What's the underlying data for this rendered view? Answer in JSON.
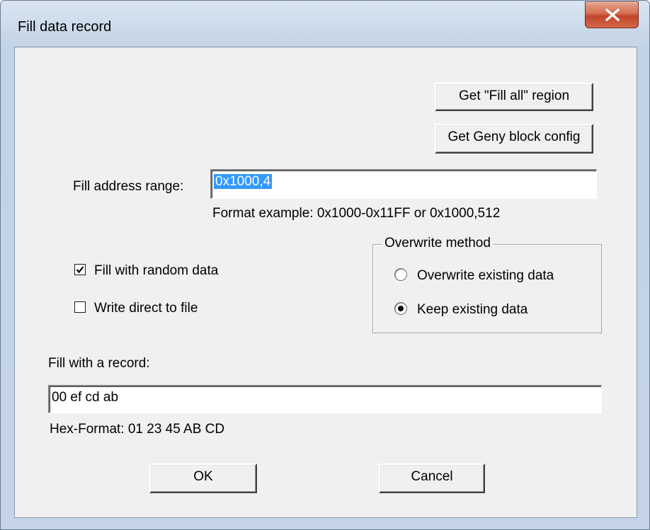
{
  "window": {
    "title": "Fill data record"
  },
  "buttons": {
    "fill_all_region": "Get \"Fill all\" region",
    "geny_block_config": "Get Geny block config",
    "ok": "OK",
    "cancel": "Cancel"
  },
  "address": {
    "label": "Fill address range:",
    "value": "0x1000,4",
    "hint": "Format example: 0x1000-0x11FF or 0x1000,512"
  },
  "options": {
    "random": {
      "label": "Fill with random data",
      "checked": true
    },
    "direct": {
      "label": "Write direct to file",
      "checked": false
    }
  },
  "overwrite": {
    "title": "Overwrite method",
    "options": [
      {
        "label": "Overwrite existing data",
        "selected": false
      },
      {
        "label": "Keep existing data",
        "selected": true
      }
    ]
  },
  "record": {
    "label": "Fill with a record:",
    "value": "00 ef cd ab",
    "hint": "Hex-Format:  01 23 45 AB CD"
  },
  "icons": {
    "close": "close-icon",
    "check": "checkmark-icon"
  }
}
